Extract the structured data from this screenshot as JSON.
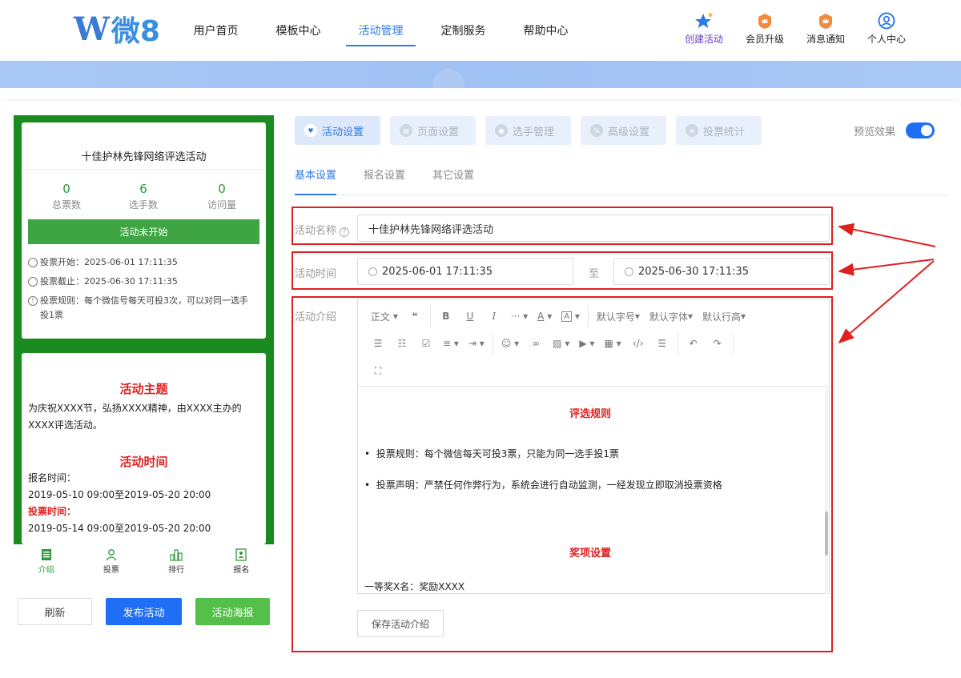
{
  "nav": {
    "links": [
      "用户首页",
      "模板中心",
      "活动管理",
      "定制服务",
      "帮助中心"
    ],
    "active_index": 2,
    "icons": [
      {
        "label": "创建活动",
        "icon": "star-icon"
      },
      {
        "label": "会员升级",
        "icon": "crown-badge-icon"
      },
      {
        "label": "消息通知",
        "icon": "bell-badge-icon"
      },
      {
        "label": "个人中心",
        "icon": "user-icon"
      }
    ]
  },
  "preview": {
    "title": "十佳护林先锋网络评选活动",
    "stats": [
      {
        "value": "0",
        "label": "总票数"
      },
      {
        "value": "6",
        "label": "选手数"
      },
      {
        "value": "0",
        "label": "访问量"
      }
    ],
    "status": "活动未开始",
    "vote_start": "投票开始：2025-06-01 17:11:35",
    "vote_end": "投票截止：2025-06-30 17:11:35",
    "vote_rule": "投票规则：每个微信号每天可投3次，可以对同一选手投1票",
    "theme_heading": "活动主题",
    "theme_text": "为庆祝XXXX节，弘扬XXXX精神，由XXXX主办的XXXX评选活动。",
    "time_heading": "活动时间",
    "signup_label": "报名时间：",
    "signup_range": "2019-05-10 09:00至2019-05-20 20:00",
    "vote_label": "投票时间：",
    "vote_range": "2019-05-14 09:00至2019-05-20 20:00",
    "tabs": [
      "介绍",
      "投票",
      "排行",
      "报名"
    ]
  },
  "actions": {
    "refresh": "刷新",
    "publish": "发布活动",
    "poster": "活动海报"
  },
  "steps": [
    "活动设置",
    "页面设置",
    "选手管理",
    "高级设置",
    "投票统计"
  ],
  "preview_toggle": {
    "label": "预览效果",
    "on": true
  },
  "subtabs": [
    "基本设置",
    "报名设置",
    "其它设置"
  ],
  "form": {
    "name_label": "活动名称",
    "name_value": "十佳护林先锋网络评选活动",
    "time_label": "活动时间",
    "time_start": "2025-06-01 17:11:35",
    "time_sep": "至",
    "time_end": "2025-06-30 17:11:35",
    "intro_label": "活动介绍"
  },
  "editor": {
    "toolbar_row1": [
      "正文",
      "❝",
      "B",
      "U",
      "I",
      "···",
      "A",
      "A",
      "默认字号",
      "默认字体",
      "默认行高"
    ],
    "rules_heading": "评选规则",
    "rule1": "投票规则：每个微信每天可投3票，只能为同一选手投1票",
    "rule2": "投票声明：严禁任何作弊行为，系统会进行自动监测，一经发现立即取消投票资格",
    "awards_heading": "奖项设置",
    "award1": "一等奖X名：奖励XXXX"
  },
  "save_button": "保存活动介绍",
  "colors": {
    "accent": "#2f7be5",
    "green": "#1a8b1f",
    "red": "#e02020"
  }
}
